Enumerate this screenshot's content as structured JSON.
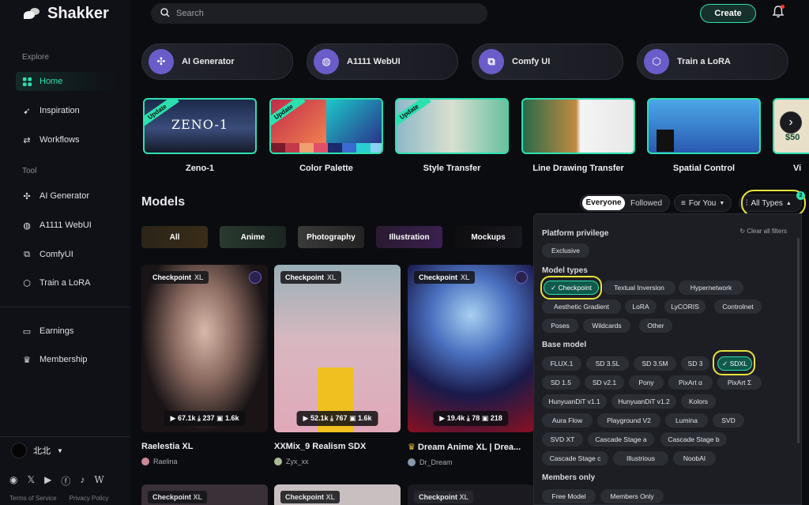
{
  "app": {
    "name": "Shakker"
  },
  "search": {
    "placeholder": "Search"
  },
  "header": {
    "create_label": "Create"
  },
  "sidebar": {
    "explore_label": "Explore",
    "tool_label": "Tool",
    "items": [
      {
        "label": "Home"
      },
      {
        "label": "Inspiration"
      },
      {
        "label": "Workflows"
      },
      {
        "label": "AI Generator"
      },
      {
        "label": "A1111 WebUI"
      },
      {
        "label": "ComfyUI"
      },
      {
        "label": "Train a LoRA"
      },
      {
        "label": "Earnings"
      },
      {
        "label": "Membership"
      }
    ],
    "user_name": "北北",
    "footer": {
      "terms": "Terms of Service",
      "privacy": "Privacy Policy"
    }
  },
  "tools": [
    {
      "label": "AI Generator"
    },
    {
      "label": "A1111 WebUI"
    },
    {
      "label": "Comfy UI"
    },
    {
      "label": "Train a LoRA"
    }
  ],
  "features": [
    {
      "label": "Zeno-1",
      "ribbon": "Update",
      "overlay": "ZENO-1"
    },
    {
      "label": "Color Palette",
      "ribbon": "Update"
    },
    {
      "label": "Style Transfer",
      "ribbon": "Update"
    },
    {
      "label": "Line Drawing Transfer"
    },
    {
      "label": "Spatial Control"
    },
    {
      "label": "Vi",
      "overlay": "$50"
    }
  ],
  "models": {
    "title": "Models",
    "audience": {
      "everyone": "Everyone",
      "followed": "Followed"
    },
    "sort_label": "For You",
    "types_label": "All Types",
    "types_count": "2",
    "categories": [
      "All",
      "Anime",
      "Photography",
      "Illustration",
      "Mockups"
    ],
    "cards": [
      {
        "tag": "Checkpoint",
        "base": "XL",
        "stats": "▶ 67.1k  ⤓ 237  ▣ 1.6k",
        "title": "Raelestia XL",
        "author": "Raelina"
      },
      {
        "tag": "Checkpoint",
        "base": "XL",
        "stats": "▶ 52.1k  ⤓ 767  ▣ 1.6k",
        "title": "XXMix_9 Realism SDX",
        "author": "Zyx_xx"
      },
      {
        "tag": "Checkpoint",
        "base": "XL",
        "stats": "▶ 19.4k  ⤓ 78  ▣ 218",
        "title": "Dream Anime XL | Drea...",
        "author": "Dr_Dream"
      }
    ],
    "second_row_tags": [
      {
        "tag": "Checkpoint",
        "base": "XL"
      },
      {
        "tag": "Checkpoint",
        "base": "XL"
      },
      {
        "tag": "Checkpoint",
        "base": "XL"
      }
    ]
  },
  "filter_panel": {
    "clear_label": "Clear all filters",
    "sections": {
      "platform": "Platform privilege",
      "model_types": "Model types",
      "base_model": "Base model",
      "members": "Members only"
    },
    "platform_chips": [
      "Exclusive"
    ],
    "model_type_chips": [
      "Checkpoint",
      "Textual Inversion",
      "Hypernetwork",
      "Aesthetic Gradient",
      "LoRA",
      "LyCORIS",
      "Controlnet",
      "Poses",
      "Wildcards",
      "Other"
    ],
    "base_model_chips": [
      "FLUX.1",
      "SD 3.5L",
      "SD 3.5M",
      "SD 3",
      "SDXL",
      "SD 1.5",
      "SD v2.1",
      "Pony",
      "PixArt α",
      "PixArt Σ",
      "HunyuanDiT v1.1",
      "HunyuanDiT v1.2",
      "Kolors",
      "Aura Flow",
      "Playground V2",
      "Lumina",
      "SVD",
      "SVD XT",
      "Cascade Stage a",
      "Cascade Stage b",
      "Cascade Stage c",
      "Illustrious",
      "NoobAI"
    ],
    "members_chips": [
      "Free Model",
      "Members Only"
    ],
    "selected": [
      "Checkpoint",
      "SDXL"
    ]
  },
  "colors": {
    "accent": "#2de0b0",
    "highlight": "#e8e23a",
    "tool_circle": "#6a5cc9"
  }
}
